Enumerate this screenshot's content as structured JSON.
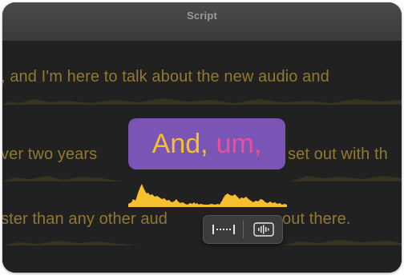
{
  "window": {
    "title": "Script"
  },
  "script": {
    "lines": [
      ", and I'm here to talk about the new audio and",
      "ver two years",
      "set out with th",
      "ster than any other aud",
      "out there."
    ]
  },
  "selection": {
    "word1": "And,",
    "word2": "um,"
  },
  "colors": {
    "script_text": "#a6893a",
    "selection_bg": "#7a55b6",
    "word_and": "#f4c02e",
    "word_um": "#ea4f9a",
    "waveform": "#f4c02e"
  },
  "toolbar": {
    "buttons": [
      {
        "icon": "trim-gap-icon"
      },
      {
        "icon": "waveform-icon"
      }
    ]
  }
}
